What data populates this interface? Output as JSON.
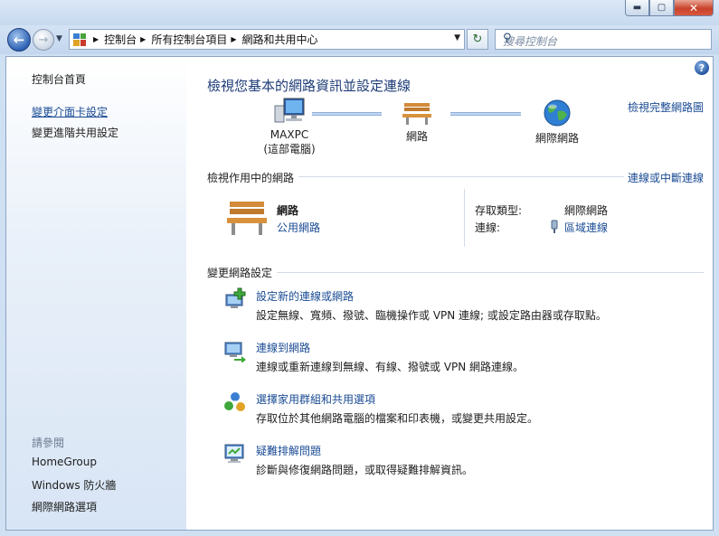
{
  "window": {
    "minimize_glyph": "▬",
    "maximize_glyph": "▢",
    "close_glyph": "✕"
  },
  "navbar": {
    "breadcrumbs": [
      "控制台",
      "所有控制台項目",
      "網路和共用中心"
    ],
    "search_placeholder": "搜尋控制台"
  },
  "sidebar": {
    "home": "控制台首頁",
    "links": [
      "變更介面卡設定",
      "變更進階共用設定"
    ],
    "see_also_title": "請參閱",
    "see_also": [
      "HomeGroup",
      "Windows 防火牆",
      "網際網路選項"
    ]
  },
  "main": {
    "title": "檢視您基本的網路資訊並設定連線",
    "full_map_link": "檢視完整網路圖",
    "map": {
      "computer_name": "MAXPC",
      "computer_sub": "(這部電腦)",
      "network": "網路",
      "internet": "網際網路"
    },
    "active": {
      "header": "檢視作用中的網路",
      "disconnect_link": "連線或中斷連線",
      "network_name": "網路",
      "network_type": "公用網路",
      "access_type_label": "存取類型:",
      "access_type_value": "網際網路",
      "connections_label": "連線:",
      "connections_value": "區域連線"
    },
    "change": {
      "header": "變更網路設定",
      "tasks": [
        {
          "title": "設定新的連線或網路",
          "desc": "設定無線、寬頻、撥號、臨機操作或 VPN 連線; 或設定路由器或存取點。",
          "icon": "new-connection-icon"
        },
        {
          "title": "連線到網路",
          "desc": "連線或重新連線到無線、有線、撥號或 VPN 網路連線。",
          "icon": "connect-network-icon"
        },
        {
          "title": "選擇家用群組和共用選項",
          "desc": "存取位於其他網路電腦的檔案和印表機，或變更共用設定。",
          "icon": "homegroup-icon"
        },
        {
          "title": "疑難排解問題",
          "desc": "診斷與修復網路問題，或取得疑難排解資訊。",
          "icon": "troubleshoot-icon"
        }
      ]
    }
  },
  "colors": {
    "link": "#1a4b94",
    "title": "#1e3c78",
    "sidebar_bottom": "#d8e5f5"
  }
}
